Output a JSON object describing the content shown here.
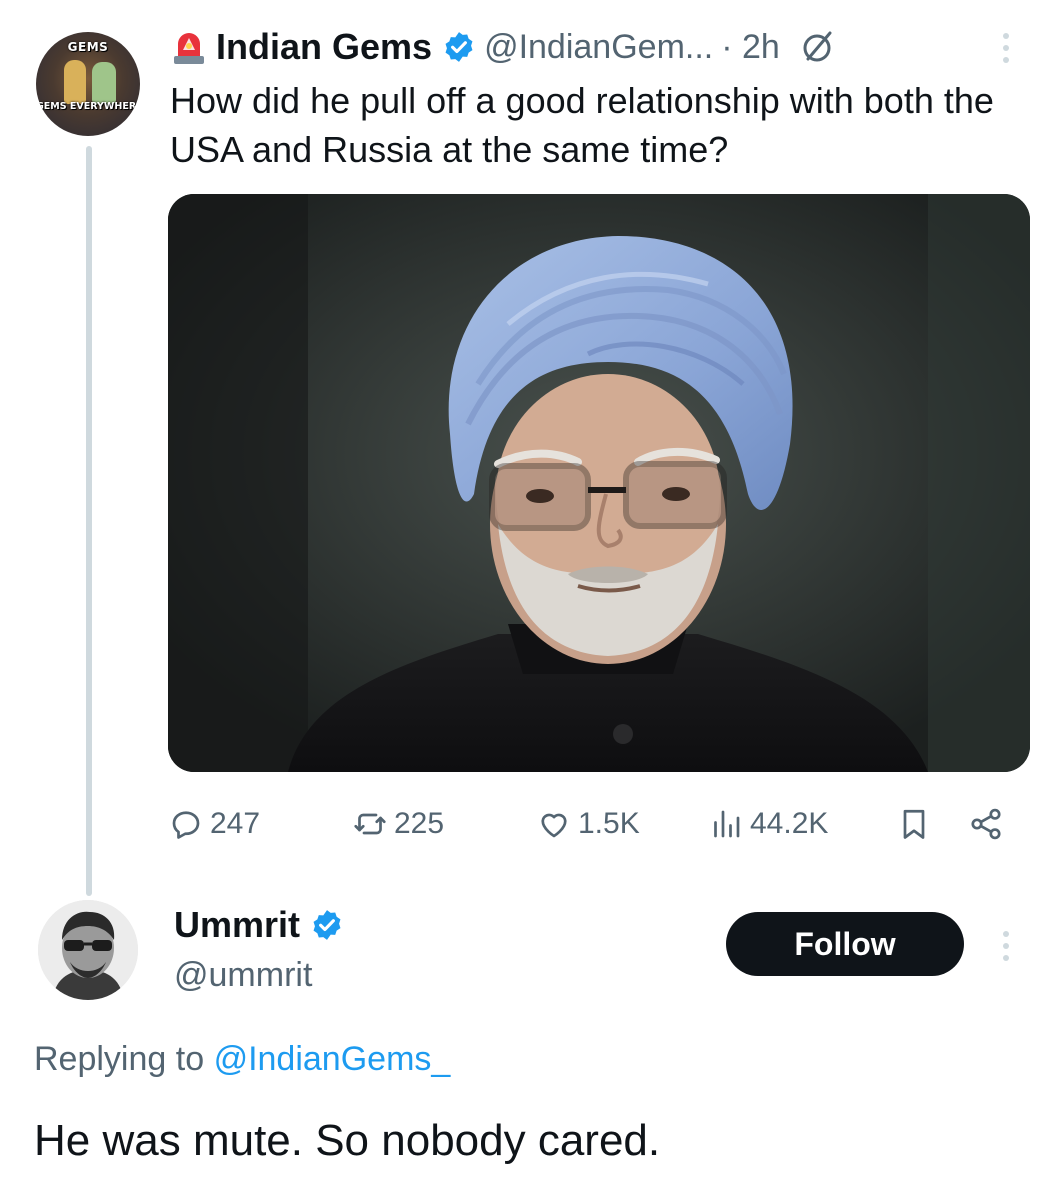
{
  "tweet": {
    "avatar_top_text": "GEMS",
    "avatar_bottom_text": "GEMS EVERYWHERE",
    "author_name": "Indian Gems",
    "author_handle": "@IndianGem...",
    "timestamp": "· 2h",
    "text": "How did he pull off a good relationship with both the USA and Russia at the same time?",
    "icons": {
      "siren": "siren-emoji-icon",
      "verified": "verified-badge-icon",
      "grok": "grok-icon",
      "more": "more-vertical-icon"
    },
    "metrics": {
      "replies": "247",
      "reposts": "225",
      "likes": "1.5K",
      "views": "44.2K"
    }
  },
  "reply": {
    "author_name": "Ummrit",
    "author_handle": "@ummrit",
    "follow_label": "Follow",
    "replying_prefix": "Replying to",
    "replying_mention": "@IndianGems_",
    "text": "He was mute. So nobody cared."
  },
  "colors": {
    "text": "#0f1419",
    "secondary": "#536471",
    "accent": "#1d9bf0",
    "button": "#0f1419",
    "thread_line": "#cfd9de"
  }
}
